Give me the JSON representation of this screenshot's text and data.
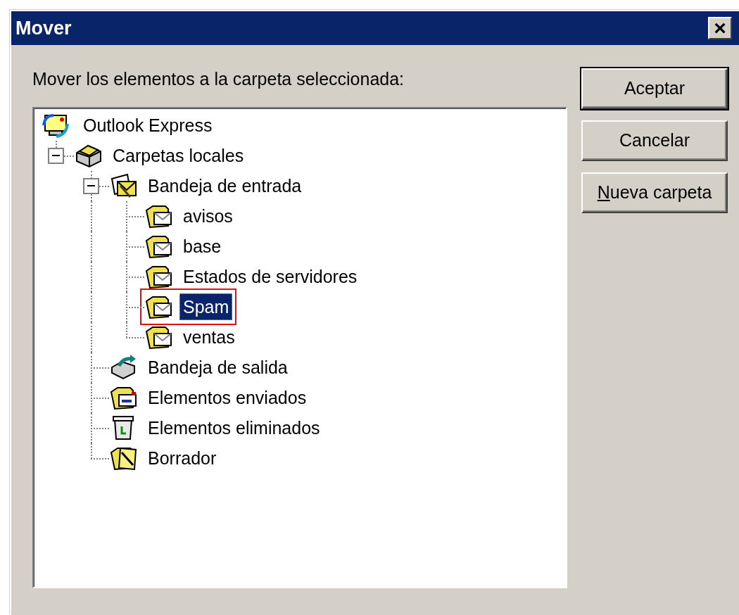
{
  "window": {
    "title": "Mover",
    "close": "×"
  },
  "prompt": "Mover los elementos a la carpeta seleccionada:",
  "tree": [
    {
      "label": "Outlook Express",
      "kind": "computer",
      "selected": false,
      "annotated": false,
      "children": [
        {
          "label": "Carpetas locales",
          "kind": "storage",
          "selected": false,
          "annotated": false,
          "expanded": true,
          "children": [
            {
              "label": "Bandeja de entrada",
              "kind": "inbox",
              "selected": false,
              "annotated": false,
              "expanded": true,
              "children": [
                {
                  "label": "avisos",
                  "kind": "folder",
                  "selected": false,
                  "annotated": false
                },
                {
                  "label": "base",
                  "kind": "folder",
                  "selected": false,
                  "annotated": false
                },
                {
                  "label": "Estados de servidores",
                  "kind": "folder",
                  "selected": false,
                  "annotated": false
                },
                {
                  "label": "Spam",
                  "kind": "folder",
                  "selected": true,
                  "annotated": true
                },
                {
                  "label": "ventas",
                  "kind": "folder",
                  "selected": false,
                  "annotated": false
                }
              ]
            },
            {
              "label": "Bandeja de salida",
              "kind": "outbox",
              "selected": false,
              "annotated": false
            },
            {
              "label": "Elementos enviados",
              "kind": "sent",
              "selected": false,
              "annotated": false
            },
            {
              "label": "Elementos eliminados",
              "kind": "trash",
              "selected": false,
              "annotated": false
            },
            {
              "label": "Borrador",
              "kind": "drafts",
              "selected": false,
              "annotated": false
            }
          ]
        }
      ]
    }
  ],
  "buttons": [
    {
      "label": "Aceptar",
      "default": true
    },
    {
      "label": "Cancelar",
      "default": false
    },
    {
      "label": "Nueva carpeta",
      "default": false,
      "mnemonic_underlined": true
    }
  ]
}
